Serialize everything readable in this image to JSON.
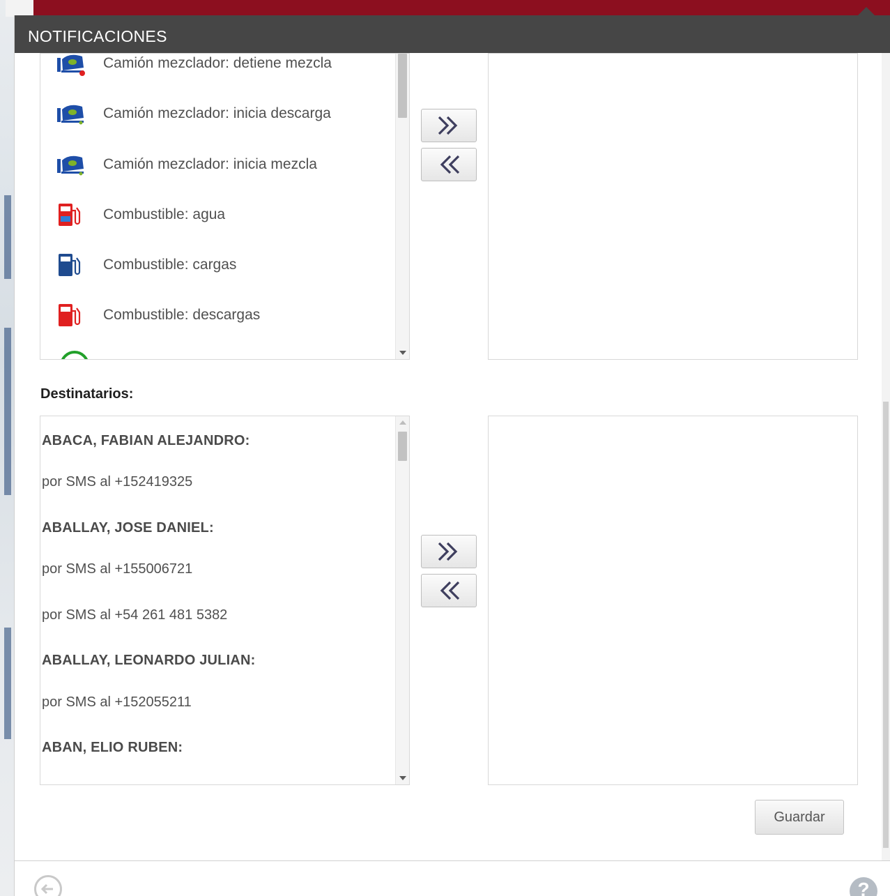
{
  "dialog": {
    "title": "NOTIFICACIONES"
  },
  "events": {
    "items": [
      {
        "label": "Camión mezclador: detiene mezcla",
        "icon": "mixer-truck-stop-icon"
      },
      {
        "label": "Camión mezclador: inicia descarga",
        "icon": "mixer-truck-icon"
      },
      {
        "label": "Camión mezclador: inicia mezcla",
        "icon": "mixer-truck-icon"
      },
      {
        "label": "Combustible: agua",
        "icon": "fuel-pump-water-icon"
      },
      {
        "label": "Combustible: cargas",
        "icon": "fuel-pump-load-icon"
      },
      {
        "label": "Combustible: descargas",
        "icon": "fuel-pump-unload-icon"
      }
    ]
  },
  "recipients": {
    "label": "Destinatarios:",
    "items": [
      {
        "name": "ABACA, FABIAN ALEJANDRO:",
        "contacts": [
          "por SMS al +152419325"
        ]
      },
      {
        "name": "ABALLAY, JOSE DANIEL:",
        "contacts": [
          "por SMS al +155006721",
          "por SMS al +54 261 481 5382"
        ]
      },
      {
        "name": "ABALLAY, LEONARDO JULIAN:",
        "contacts": [
          "por SMS al +152055211"
        ]
      },
      {
        "name": "ABAN, ELIO RUBEN:",
        "contacts": []
      }
    ]
  },
  "buttons": {
    "add_glyph": "»",
    "remove_glyph": "«",
    "save_label": "Guardar"
  },
  "footer": {
    "help_glyph": "?"
  },
  "colors": {
    "header_bg": "#464646",
    "top_bar": "#8c0f1f",
    "mixer_blue": "#1e4ea8",
    "mixer_green": "#7fb32a",
    "fuel_red": "#e02020",
    "fuel_blue": "#1f4b8f"
  }
}
